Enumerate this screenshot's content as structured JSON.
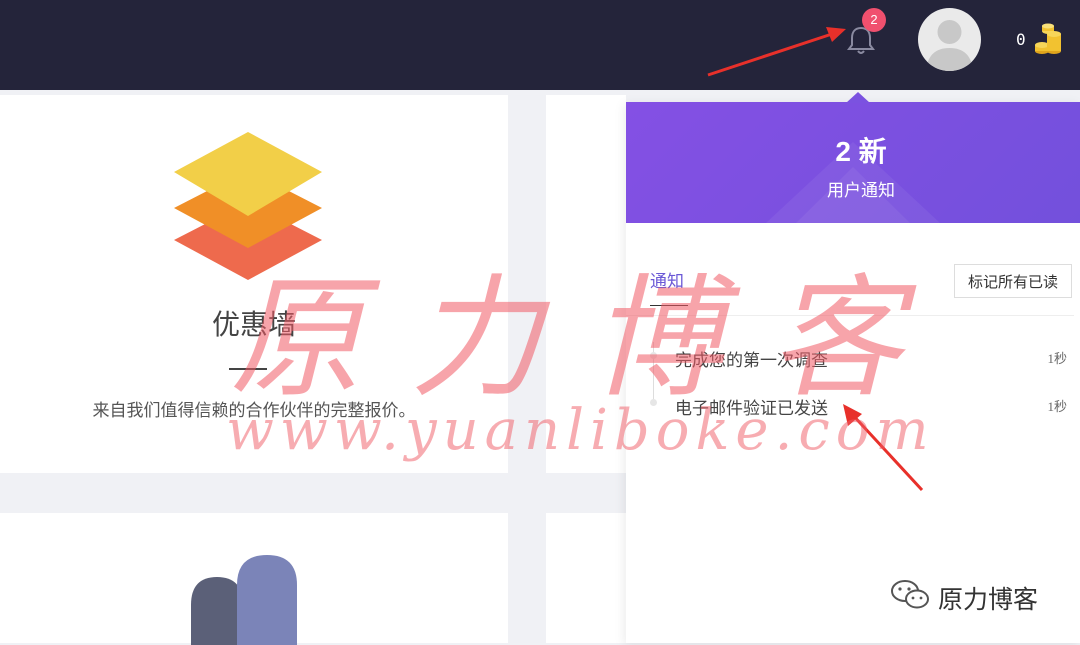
{
  "header": {
    "notification_count": "2",
    "coin_balance": "0"
  },
  "card": {
    "title": "优惠墙",
    "description": "来自我们值得信赖的合作伙伴的完整报价。"
  },
  "notifications_panel": {
    "new_count_label": "2 新",
    "subtitle": "用户通知",
    "tab_label": "通知",
    "mark_all_read_label": "标记所有已读",
    "items": [
      {
        "text": "完成您的第一次调查",
        "time": "1秒"
      },
      {
        "text": "电子邮件验证已发送",
        "time": "1秒"
      }
    ]
  },
  "watermark": {
    "chars": "原力博客",
    "url": "www.yuanliboke.com"
  },
  "footer": {
    "brand": "原力博客"
  },
  "colors": {
    "topbar": "#24243a",
    "panel_header": "#7b52e0",
    "badge": "#f0506e",
    "accent_text": "#6a58d6"
  },
  "icons": [
    "bell-icon",
    "avatar-placeholder",
    "coins-icon",
    "layers-icon",
    "people-icon",
    "wechat-icon"
  ]
}
